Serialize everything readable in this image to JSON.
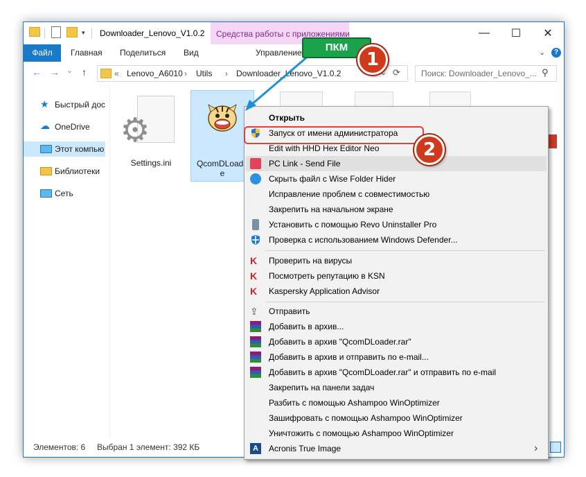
{
  "window": {
    "title": "Downloader_Lenovo_V1.0.2",
    "context_tab_header": "Средства работы с приложениями",
    "controls": {
      "minimize": "—",
      "maximize": "☐",
      "close": "✕"
    }
  },
  "ribbon": {
    "tabs": [
      "Файл",
      "Главная",
      "Поделиться",
      "Вид",
      "Управление"
    ],
    "expand_icon": "chevron-down-icon",
    "help_icon": "help-icon"
  },
  "address": {
    "back": "←",
    "forward": "→",
    "recent": "⌄",
    "up": "↑",
    "overflow": "«",
    "crumbs": [
      "Lenovo_A6010",
      "Utils",
      "Downloader_Lenovo_V1.0.2"
    ],
    "separator": "›",
    "search_placeholder": "Поиск: Downloader_Lenovo_..."
  },
  "nav": {
    "items": [
      {
        "label": "Быстрый дос",
        "icon": "star-icon"
      },
      {
        "label": "OneDrive",
        "icon": "cloud-icon"
      },
      {
        "label": "Этот компью",
        "icon": "computer-icon"
      },
      {
        "label": "Библиотеки",
        "icon": "library-icon"
      },
      {
        "label": "Сеть",
        "icon": "network-icon"
      }
    ]
  },
  "files": [
    {
      "name": "Settings.ini",
      "icon": "settings-file-icon"
    },
    {
      "name": "QcomDLoader.exe",
      "name_line1": "QcomDLoade",
      "name_line2": "e",
      "icon": "tiger-icon"
    }
  ],
  "status": {
    "count": "Элементов: 6",
    "selection": "Выбран 1 элемент: 392 КБ"
  },
  "context_menu": {
    "items": [
      {
        "label": "Открыть",
        "bold": true
      },
      {
        "label": "Запуск от имени администратора",
        "icon": "shield-icon"
      },
      {
        "label": "Edit with HHD Hex Editor Neo"
      },
      {
        "label": "PC Link - Send File",
        "icon": "pc-link-icon"
      },
      {
        "label": "Скрыть файл с Wise Folder Hider",
        "icon": "wise-icon"
      },
      {
        "label": "Исправление проблем с совместимостью"
      },
      {
        "label": "Закрепить на начальном экране"
      },
      {
        "label": "Установить с помощью Revo Uninstaller Pro",
        "icon": "revo-icon"
      },
      {
        "label": "Проверка с использованием Windows Defender...",
        "icon": "defender-icon"
      },
      {
        "label": "Проверить на вирусы",
        "icon": "kaspersky-icon"
      },
      {
        "label": "Посмотреть репутацию в KSN",
        "icon": "kaspersky-icon"
      },
      {
        "label": "Kaspersky Application Advisor",
        "icon": "kaspersky-icon"
      },
      {
        "label": "Отправить",
        "icon": "share-icon"
      },
      {
        "label": "Добавить в архив...",
        "icon": "winrar-icon"
      },
      {
        "label": "Добавить в архив \"QcomDLoader.rar\"",
        "icon": "winrar-icon"
      },
      {
        "label": "Добавить в архив и отправить по e-mail...",
        "icon": "winrar-icon"
      },
      {
        "label": "Добавить в архив \"QcomDLoader.rar\" и отправить по e-mail",
        "icon": "winrar-icon"
      },
      {
        "label": "Закрепить на панели задач"
      },
      {
        "label": "Разбить с помощью Ashampoo WinOptimizer"
      },
      {
        "label": "Зашифровать с помощью Ashampoo WinOptimizer"
      },
      {
        "label": "Уничтожить с помощью Ashampoo WinOptimizer"
      },
      {
        "label": "Acronis True Image",
        "icon": "acronis-icon",
        "submenu": "›"
      }
    ]
  },
  "annotations": {
    "pkm_label": "ПКМ",
    "step1": "1",
    "step2": "2"
  },
  "colors": {
    "accent": "#1979ca",
    "context_tab": "#f5d6f7",
    "selection": "#cce8ff",
    "annotation_green": "#1aa34a",
    "annotation_red": "#cf3a1d"
  }
}
